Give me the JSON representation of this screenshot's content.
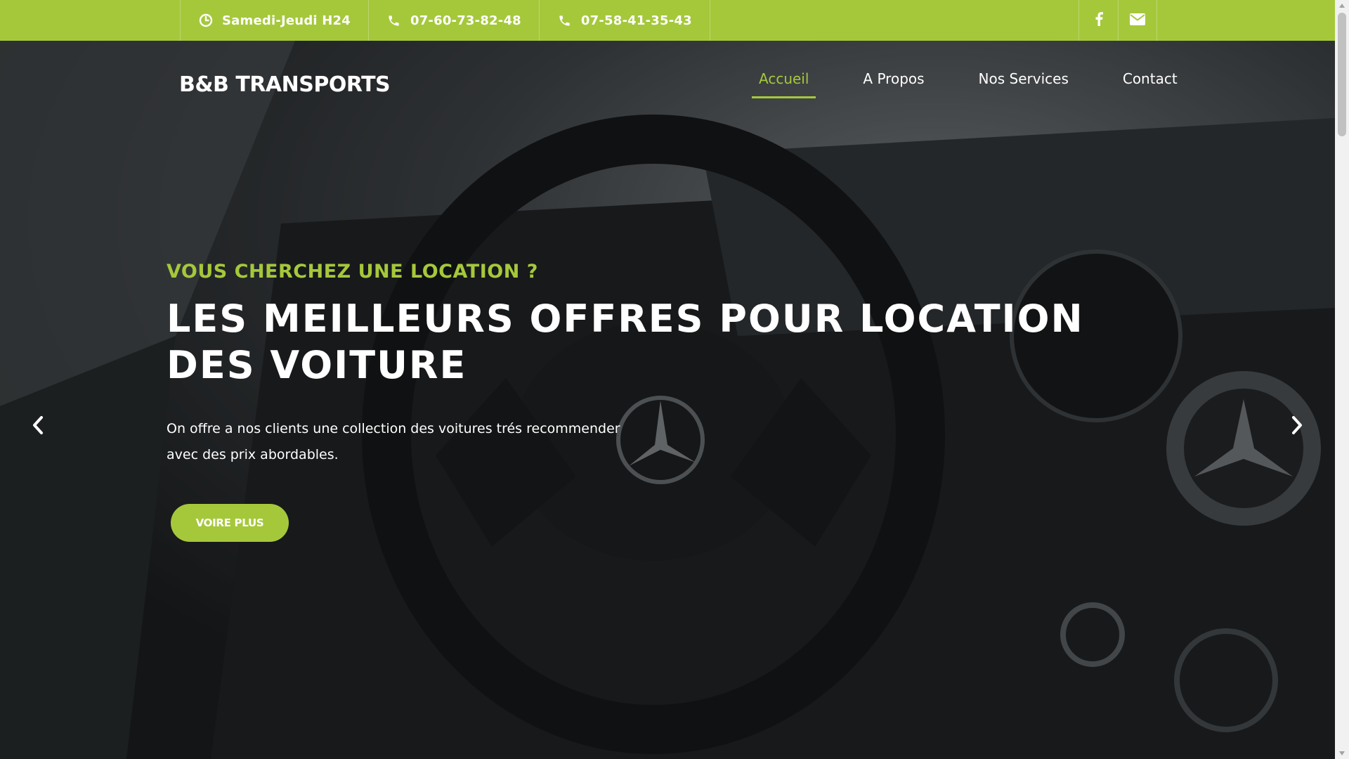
{
  "topbar": {
    "hours": "Samedi-Jeudi H24",
    "phone1": "07-60-73-82-48",
    "phone2": "07-58-41-35-43",
    "icons": {
      "hours": "clock-icon",
      "phone": "phone-icon",
      "facebook": "facebook-icon",
      "mail": "envelope-icon"
    }
  },
  "header": {
    "brand": "B&B TRANSPORTS",
    "nav": [
      {
        "label": "Accueil",
        "active": true
      },
      {
        "label": "A Propos",
        "active": false
      },
      {
        "label": "Nos Services",
        "active": false
      },
      {
        "label": "Contact",
        "active": false
      }
    ]
  },
  "hero": {
    "kicker": "VOUS CHERCHEZ UNE LOCATION ?",
    "headline": "LES MEILLEURS OFFRES POUR LOCATION DES VOITURE",
    "description": "On offre a nos clients une collection des voitures trés recommender avec des prix abordables.",
    "cta": "VOIRE PLUS",
    "background": "car-interior-steering-wheel"
  },
  "colors": {
    "accent": "#a5c83b",
    "text": "#ffffff"
  }
}
